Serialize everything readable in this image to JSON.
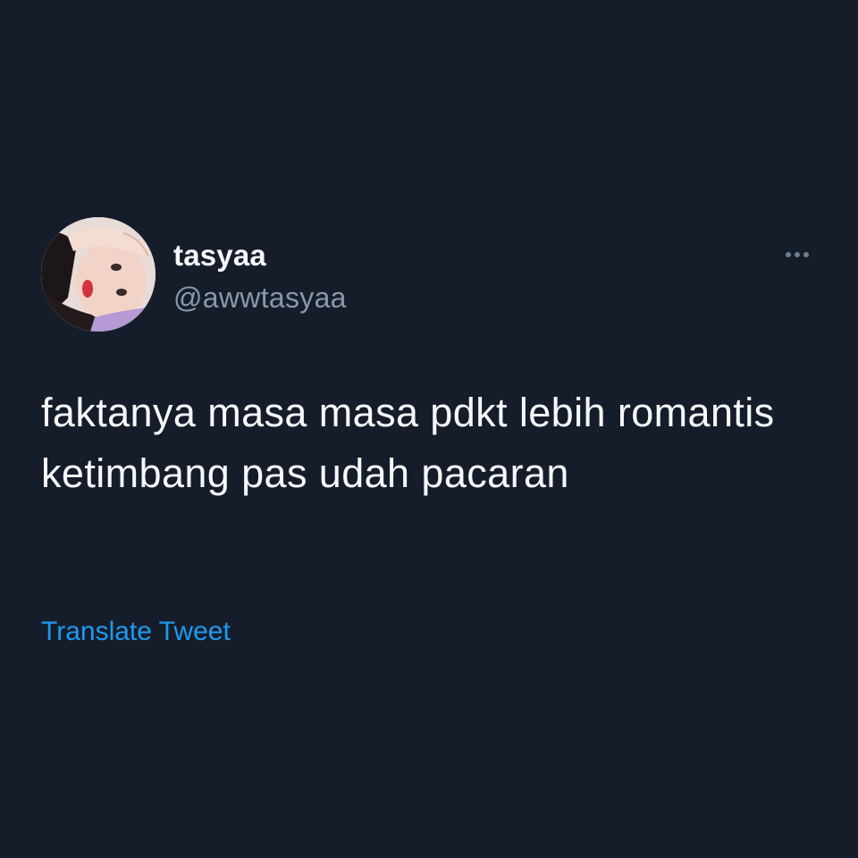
{
  "tweet": {
    "author": {
      "display_name": "tasyaa",
      "handle": "@awwtasyaa"
    },
    "text": "faktanya masa masa pdkt lebih romantis ketimbang pas udah pacaran",
    "translate_label": "Translate Tweet",
    "more_icon": "more-horizontal-icon"
  },
  "colors": {
    "background": "#161d2a",
    "text_primary": "#f5f7f9",
    "text_secondary": "#8a97a6",
    "accent": "#1d9bf0"
  }
}
